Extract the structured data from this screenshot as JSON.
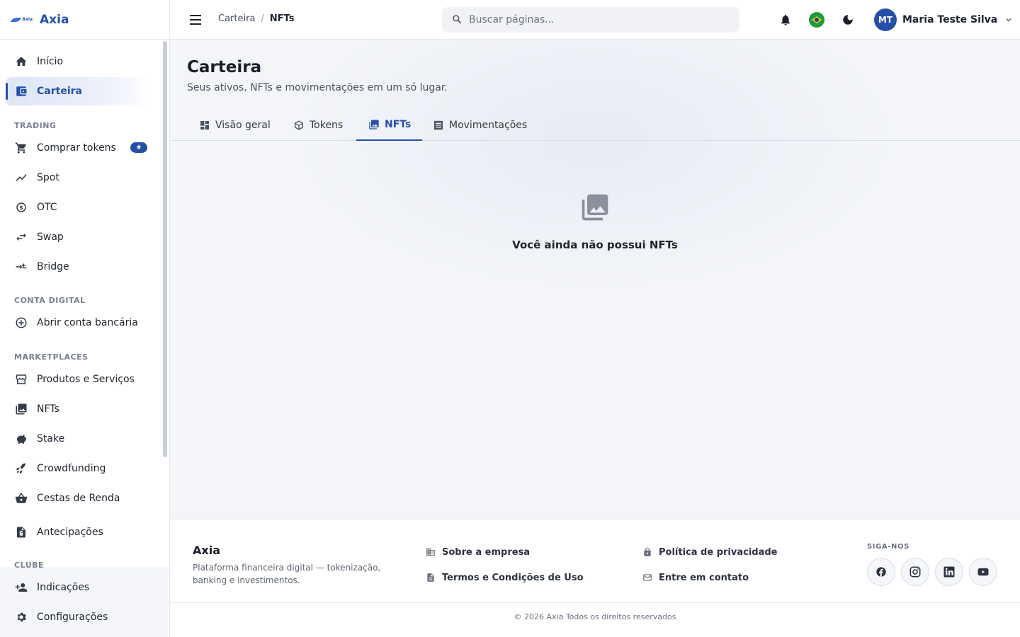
{
  "brand": {
    "logo_text": "Axia",
    "name": "Axia"
  },
  "sidebar": {
    "items_top": [
      {
        "label": "Início",
        "icon": "home-icon"
      },
      {
        "label": "Carteira",
        "icon": "wallet-icon",
        "active": true
      }
    ],
    "sections": [
      {
        "label": "TRADING"
      },
      {
        "label": "CONTA DIGITAL"
      },
      {
        "label": "MARKETPLACES"
      },
      {
        "label": "CLUBE"
      }
    ],
    "trading": [
      {
        "label": "Comprar tokens",
        "icon": "cart-icon",
        "badge": "★"
      },
      {
        "label": "Spot",
        "icon": "trend-icon"
      },
      {
        "label": "OTC",
        "icon": "currency-exchange-icon"
      },
      {
        "label": "Swap",
        "icon": "swap-icon"
      },
      {
        "label": "Bridge",
        "icon": "bridge-icon"
      }
    ],
    "conta_digital": [
      {
        "label": "Abrir conta bancária",
        "icon": "add-circle-icon"
      }
    ],
    "marketplaces": [
      {
        "label": "Produtos e Serviços",
        "icon": "store-icon"
      },
      {
        "label": "NFTs",
        "icon": "collections-icon"
      },
      {
        "label": "Stake",
        "icon": "piggy-bank-icon"
      },
      {
        "label": "Crowdfunding",
        "icon": "rocket-icon"
      },
      {
        "label": "Cestas de Renda",
        "icon": "basket-icon"
      },
      {
        "label": "Antecipações",
        "icon": "request-quote-icon"
      }
    ],
    "bottom": [
      {
        "label": "Indicações",
        "icon": "person-add-icon"
      },
      {
        "label": "Configurações",
        "icon": "gear-icon"
      }
    ]
  },
  "topbar": {
    "breadcrumb": {
      "parent": "Carteira",
      "separator": "/",
      "current": "NFTs"
    },
    "search_placeholder": "Buscar páginas...",
    "user": {
      "initials": "MT",
      "name": "Maria Teste Silva"
    }
  },
  "page": {
    "title": "Carteira",
    "subtitle": "Seus ativos, NFTs e movimentações em um só lugar.",
    "tabs": [
      {
        "label": "Visão geral",
        "icon": "dashboard-icon"
      },
      {
        "label": "Tokens",
        "icon": "token-icon"
      },
      {
        "label": "NFTs",
        "icon": "collections-icon",
        "active": true
      },
      {
        "label": "Movimentações",
        "icon": "receipt-icon"
      }
    ],
    "empty_text": "Você ainda não possui NFTs"
  },
  "footer": {
    "brand": "Axia",
    "description": "Plataforma financeira digital — tokenização, banking e investimentos.",
    "links": [
      {
        "label": "Sobre a empresa",
        "icon": "building-icon"
      },
      {
        "label": "Termos e Condições de Uso",
        "icon": "document-icon"
      },
      {
        "label": "Política de privacidade",
        "icon": "lock-icon"
      },
      {
        "label": "Entre em contato",
        "icon": "mail-icon"
      }
    ],
    "follow_label": "SIGA-NOS",
    "social": [
      "facebook-icon",
      "instagram-icon",
      "linkedin-icon",
      "youtube-icon"
    ],
    "copyright": "© 2026 Axia Todos os direitos reservados"
  },
  "colors": {
    "accent": "#2650a8",
    "background": "#f3f5f9"
  }
}
